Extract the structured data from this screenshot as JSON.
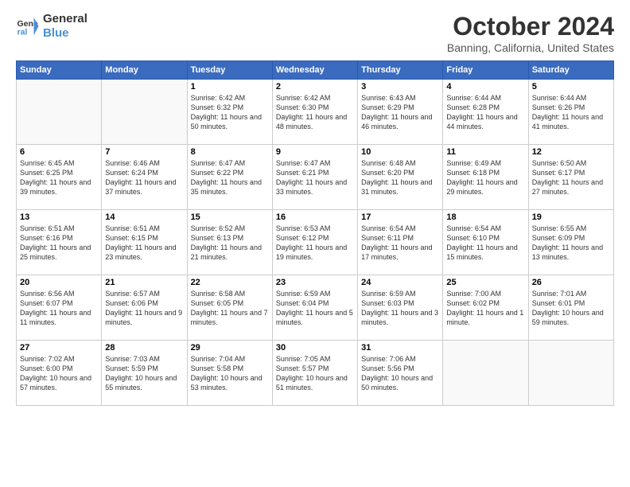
{
  "header": {
    "logo_line1": "General",
    "logo_line2": "Blue",
    "month": "October 2024",
    "location": "Banning, California, United States"
  },
  "days_of_week": [
    "Sunday",
    "Monday",
    "Tuesday",
    "Wednesday",
    "Thursday",
    "Friday",
    "Saturday"
  ],
  "weeks": [
    [
      {
        "day": "",
        "sunrise": "",
        "sunset": "",
        "daylight": ""
      },
      {
        "day": "",
        "sunrise": "",
        "sunset": "",
        "daylight": ""
      },
      {
        "day": "1",
        "sunrise": "Sunrise: 6:42 AM",
        "sunset": "Sunset: 6:32 PM",
        "daylight": "Daylight: 11 hours and 50 minutes."
      },
      {
        "day": "2",
        "sunrise": "Sunrise: 6:42 AM",
        "sunset": "Sunset: 6:30 PM",
        "daylight": "Daylight: 11 hours and 48 minutes."
      },
      {
        "day": "3",
        "sunrise": "Sunrise: 6:43 AM",
        "sunset": "Sunset: 6:29 PM",
        "daylight": "Daylight: 11 hours and 46 minutes."
      },
      {
        "day": "4",
        "sunrise": "Sunrise: 6:44 AM",
        "sunset": "Sunset: 6:28 PM",
        "daylight": "Daylight: 11 hours and 44 minutes."
      },
      {
        "day": "5",
        "sunrise": "Sunrise: 6:44 AM",
        "sunset": "Sunset: 6:26 PM",
        "daylight": "Daylight: 11 hours and 41 minutes."
      }
    ],
    [
      {
        "day": "6",
        "sunrise": "Sunrise: 6:45 AM",
        "sunset": "Sunset: 6:25 PM",
        "daylight": "Daylight: 11 hours and 39 minutes."
      },
      {
        "day": "7",
        "sunrise": "Sunrise: 6:46 AM",
        "sunset": "Sunset: 6:24 PM",
        "daylight": "Daylight: 11 hours and 37 minutes."
      },
      {
        "day": "8",
        "sunrise": "Sunrise: 6:47 AM",
        "sunset": "Sunset: 6:22 PM",
        "daylight": "Daylight: 11 hours and 35 minutes."
      },
      {
        "day": "9",
        "sunrise": "Sunrise: 6:47 AM",
        "sunset": "Sunset: 6:21 PM",
        "daylight": "Daylight: 11 hours and 33 minutes."
      },
      {
        "day": "10",
        "sunrise": "Sunrise: 6:48 AM",
        "sunset": "Sunset: 6:20 PM",
        "daylight": "Daylight: 11 hours and 31 minutes."
      },
      {
        "day": "11",
        "sunrise": "Sunrise: 6:49 AM",
        "sunset": "Sunset: 6:18 PM",
        "daylight": "Daylight: 11 hours and 29 minutes."
      },
      {
        "day": "12",
        "sunrise": "Sunrise: 6:50 AM",
        "sunset": "Sunset: 6:17 PM",
        "daylight": "Daylight: 11 hours and 27 minutes."
      }
    ],
    [
      {
        "day": "13",
        "sunrise": "Sunrise: 6:51 AM",
        "sunset": "Sunset: 6:16 PM",
        "daylight": "Daylight: 11 hours and 25 minutes."
      },
      {
        "day": "14",
        "sunrise": "Sunrise: 6:51 AM",
        "sunset": "Sunset: 6:15 PM",
        "daylight": "Daylight: 11 hours and 23 minutes."
      },
      {
        "day": "15",
        "sunrise": "Sunrise: 6:52 AM",
        "sunset": "Sunset: 6:13 PM",
        "daylight": "Daylight: 11 hours and 21 minutes."
      },
      {
        "day": "16",
        "sunrise": "Sunrise: 6:53 AM",
        "sunset": "Sunset: 6:12 PM",
        "daylight": "Daylight: 11 hours and 19 minutes."
      },
      {
        "day": "17",
        "sunrise": "Sunrise: 6:54 AM",
        "sunset": "Sunset: 6:11 PM",
        "daylight": "Daylight: 11 hours and 17 minutes."
      },
      {
        "day": "18",
        "sunrise": "Sunrise: 6:54 AM",
        "sunset": "Sunset: 6:10 PM",
        "daylight": "Daylight: 11 hours and 15 minutes."
      },
      {
        "day": "19",
        "sunrise": "Sunrise: 6:55 AM",
        "sunset": "Sunset: 6:09 PM",
        "daylight": "Daylight: 11 hours and 13 minutes."
      }
    ],
    [
      {
        "day": "20",
        "sunrise": "Sunrise: 6:56 AM",
        "sunset": "Sunset: 6:07 PM",
        "daylight": "Daylight: 11 hours and 11 minutes."
      },
      {
        "day": "21",
        "sunrise": "Sunrise: 6:57 AM",
        "sunset": "Sunset: 6:06 PM",
        "daylight": "Daylight: 11 hours and 9 minutes."
      },
      {
        "day": "22",
        "sunrise": "Sunrise: 6:58 AM",
        "sunset": "Sunset: 6:05 PM",
        "daylight": "Daylight: 11 hours and 7 minutes."
      },
      {
        "day": "23",
        "sunrise": "Sunrise: 6:59 AM",
        "sunset": "Sunset: 6:04 PM",
        "daylight": "Daylight: 11 hours and 5 minutes."
      },
      {
        "day": "24",
        "sunrise": "Sunrise: 6:59 AM",
        "sunset": "Sunset: 6:03 PM",
        "daylight": "Daylight: 11 hours and 3 minutes."
      },
      {
        "day": "25",
        "sunrise": "Sunrise: 7:00 AM",
        "sunset": "Sunset: 6:02 PM",
        "daylight": "Daylight: 11 hours and 1 minute."
      },
      {
        "day": "26",
        "sunrise": "Sunrise: 7:01 AM",
        "sunset": "Sunset: 6:01 PM",
        "daylight": "Daylight: 10 hours and 59 minutes."
      }
    ],
    [
      {
        "day": "27",
        "sunrise": "Sunrise: 7:02 AM",
        "sunset": "Sunset: 6:00 PM",
        "daylight": "Daylight: 10 hours and 57 minutes."
      },
      {
        "day": "28",
        "sunrise": "Sunrise: 7:03 AM",
        "sunset": "Sunset: 5:59 PM",
        "daylight": "Daylight: 10 hours and 55 minutes."
      },
      {
        "day": "29",
        "sunrise": "Sunrise: 7:04 AM",
        "sunset": "Sunset: 5:58 PM",
        "daylight": "Daylight: 10 hours and 53 minutes."
      },
      {
        "day": "30",
        "sunrise": "Sunrise: 7:05 AM",
        "sunset": "Sunset: 5:57 PM",
        "daylight": "Daylight: 10 hours and 51 minutes."
      },
      {
        "day": "31",
        "sunrise": "Sunrise: 7:06 AM",
        "sunset": "Sunset: 5:56 PM",
        "daylight": "Daylight: 10 hours and 50 minutes."
      },
      {
        "day": "",
        "sunrise": "",
        "sunset": "",
        "daylight": ""
      },
      {
        "day": "",
        "sunrise": "",
        "sunset": "",
        "daylight": ""
      }
    ]
  ]
}
